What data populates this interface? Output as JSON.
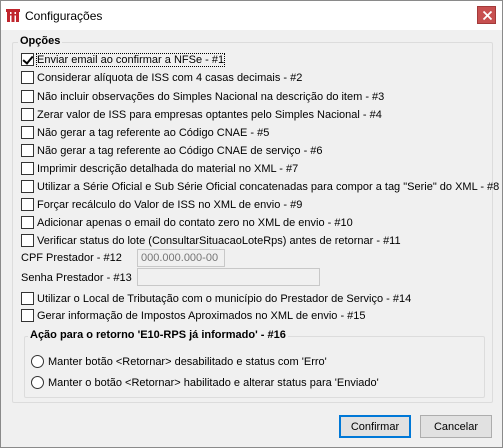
{
  "window": {
    "title": "Configurações",
    "close_symbol": "×"
  },
  "group": {
    "label": "Opções"
  },
  "options": [
    {
      "label": "Enviar email ao confirmar a NFSe - #1",
      "checked": true
    },
    {
      "label": "Considerar alíquota de ISS com 4 casas decimais  - #2",
      "checked": false
    },
    {
      "label": "Não incluir observações do Simples Nacional na descrição do item - #3",
      "checked": false
    },
    {
      "label": "Zerar valor de ISS para empresas optantes pelo Simples Nacional  - #4",
      "checked": false
    },
    {
      "label": "Não gerar a tag referente ao Código CNAE - #5",
      "checked": false
    },
    {
      "label": "Não gerar a tag referente ao Código CNAE de serviço - #6",
      "checked": false
    },
    {
      "label": "Imprimir descrição detalhada do material no XML - #7",
      "checked": false
    },
    {
      "label": "Utilizar a Série Oficial e Sub Série Oficial concatenadas para compor a tag \"Serie\" do XML - #8",
      "checked": false
    },
    {
      "label": "Forçar recálculo do Valor de ISS no XML de envio - #9",
      "checked": false
    },
    {
      "label": "Adicionar apenas o email do contato zero no XML de envio - #10",
      "checked": false
    },
    {
      "label": "Verificar status do lote (ConsultarSituacaoLoteRps) antes de retornar - #11",
      "checked": false
    }
  ],
  "cpf": {
    "label": "CPF Prestador - #12",
    "placeholder": "000.000.000-00"
  },
  "senha": {
    "label": "Senha Prestador - #13",
    "value": ""
  },
  "options_extra": [
    {
      "label": "Utilizar o Local de Tributação com o município do Prestador de Serviço - #14",
      "checked": false
    },
    {
      "label": "Gerar informação de Impostos Aproximados no XML de envio - #15",
      "checked": false
    }
  ],
  "acao": {
    "label": "Ação para o retorno 'E10-RPS já informado' - #16",
    "radios": [
      {
        "label": "Manter botão <Retornar> desabilitado e status com 'Erro'",
        "selected": false
      },
      {
        "label": "Manter o botão <Retornar> habilitado e alterar status para 'Enviado'",
        "selected": false
      }
    ]
  },
  "buttons": {
    "confirm": "Confirmar",
    "cancel": "Cancelar"
  },
  "icons": {
    "app": "app-logo-icon",
    "close": "close-icon"
  },
  "colors": {
    "close_button": "#c75050",
    "default_button_border": "#0078d7",
    "app_icon": "#c0262d"
  }
}
